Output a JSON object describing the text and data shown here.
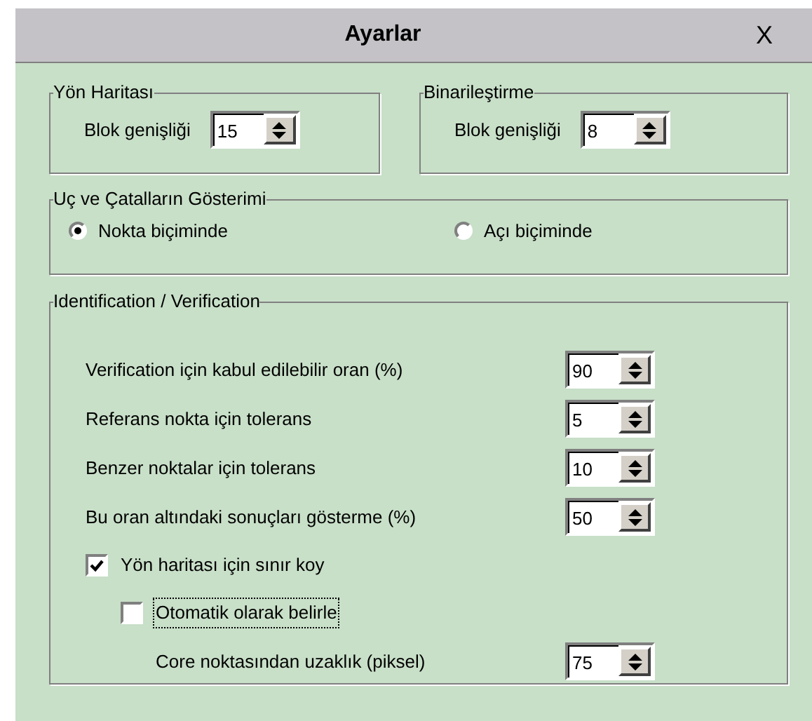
{
  "window": {
    "title": "Ayarlar",
    "close": "X"
  },
  "block_groups": [
    {
      "title": "Yön Haritası",
      "label": "Blok genişliği",
      "value": "15"
    },
    {
      "title": "Binarileştirme",
      "label": "Blok genişliği",
      "value": "8"
    }
  ],
  "display": {
    "title": "Uç ve Çatalların Gösterimi",
    "options": [
      {
        "label": "Nokta biçiminde",
        "selected": true
      },
      {
        "label": "Açı biçiminde",
        "selected": false
      }
    ]
  },
  "identification": {
    "title": "Identification / Verification",
    "rows": [
      {
        "kind": "spinner",
        "label": "Verification için kabul edilebilir oran (%)",
        "value": "90"
      },
      {
        "kind": "spinner",
        "label": "Referans nokta için tolerans",
        "value": "5"
      },
      {
        "kind": "spinner",
        "label": "Benzer noktalar için tolerans",
        "value": "10"
      },
      {
        "kind": "spinner",
        "label": "Bu oran altındaki sonuçları gösterme (%)",
        "value": "50"
      },
      {
        "kind": "checkbox",
        "label": "Yön haritası için sınır koy",
        "checked": true,
        "focused": false,
        "children": [
          {
            "kind": "checkbox",
            "label": "Otomatik olarak belirle",
            "checked": false,
            "focused": true,
            "children": [
              {
                "kind": "spinner",
                "label": "Core noktasından uzaklık (piksel)",
                "value": "75"
              }
            ]
          }
        ]
      }
    ]
  }
}
